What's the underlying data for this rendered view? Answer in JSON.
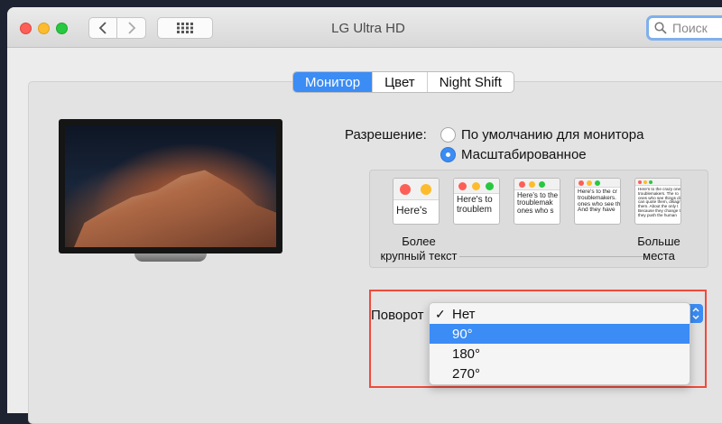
{
  "window": {
    "title": "LG Ultra HD"
  },
  "search": {
    "placeholder": "Поиск"
  },
  "tabs": [
    {
      "label": "Монитор",
      "active": true
    },
    {
      "label": "Цвет",
      "active": false
    },
    {
      "label": "Night Shift",
      "active": false
    }
  ],
  "resolution": {
    "label": "Разрешение:",
    "options": [
      {
        "label": "По умолчанию для монитора",
        "selected": false
      },
      {
        "label": "Масштабированное",
        "selected": true
      }
    ]
  },
  "scaling": {
    "left_caption": "Более\nкрупный текст",
    "right_caption": "Больше\nместа",
    "thumbs": [
      {
        "text": "Here's"
      },
      {
        "text": "Here's to\ntroublem"
      },
      {
        "text": "Here's to the\ntroublemak\nones who s"
      },
      {
        "text": "Here's to the cr\ntroublemakers.\nones who see th\nAnd they have"
      },
      {
        "text": "Here's to the crazy one\ntroublemakers. The ro\nones who see things di\ncan quote them, disagr\nthem. About the only t\nBecause they change t\nthey push the human"
      }
    ]
  },
  "rotation": {
    "label": "Поворот",
    "options": [
      {
        "label": "Нет",
        "checked": true,
        "highlighted": false
      },
      {
        "label": "90°",
        "checked": false,
        "highlighted": true
      },
      {
        "label": "180°",
        "checked": false,
        "highlighted": false
      },
      {
        "label": "270°",
        "checked": false,
        "highlighted": false
      }
    ]
  },
  "colors": {
    "accent": "#3b8cf5",
    "highlight_border": "#f04a3b"
  }
}
